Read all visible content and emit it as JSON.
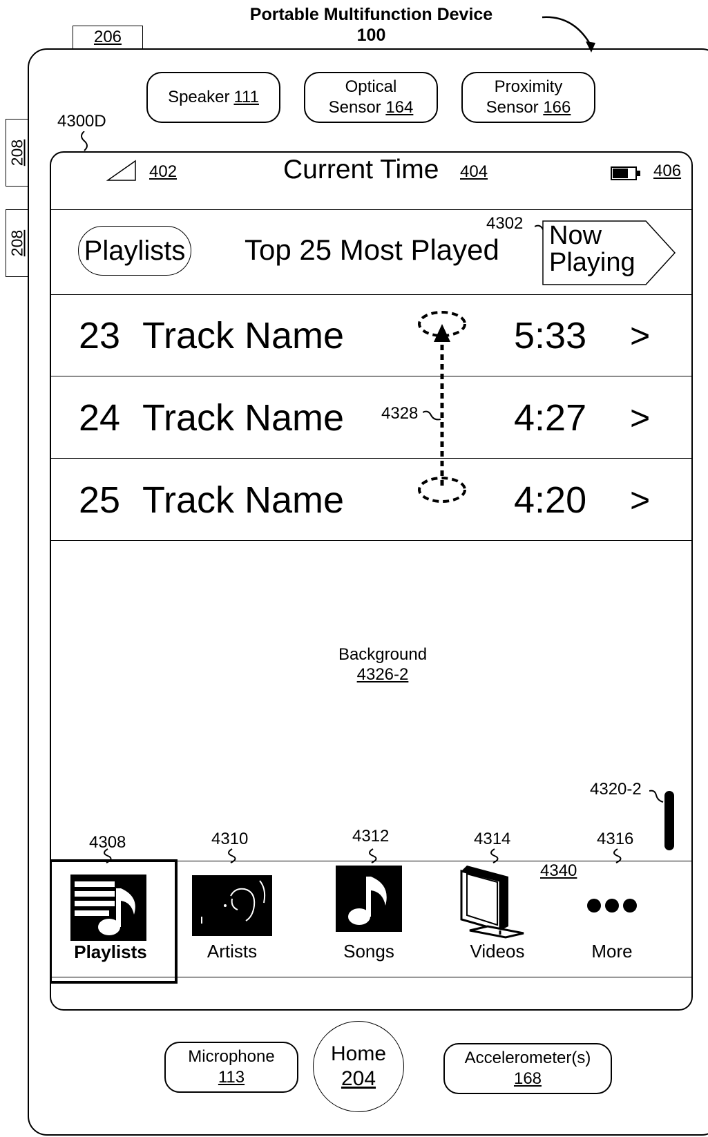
{
  "figure": {
    "title_line1": "Portable Multifunction Device",
    "title_line2": "100",
    "ref_206": "206",
    "ref_208a": "208",
    "ref_208b": "208",
    "ref_screen": "4300D"
  },
  "sensors_top": {
    "speaker_label": "Speaker",
    "speaker_ref": "111",
    "optical_label": "Optical",
    "optical_label2": "Sensor",
    "optical_ref": "164",
    "proximity_label": "Proximity",
    "proximity_label2": "Sensor",
    "proximity_ref": "166"
  },
  "status_bar": {
    "signal_ref": "402",
    "time": "Current Time",
    "time_ref": "404",
    "battery_ref": "406"
  },
  "nav_bar": {
    "back_label": "Playlists",
    "title": "Top 25 Most Played",
    "now_playing_line1": "Now",
    "now_playing_line2": "Playing",
    "now_playing_ref": "4302"
  },
  "tracks": [
    {
      "num": "23",
      "name": "Track Name",
      "duration": "5:33",
      "chevron": ">"
    },
    {
      "num": "24",
      "name": "Track Name",
      "duration": "4:27",
      "chevron": ">"
    },
    {
      "num": "25",
      "name": "Track Name",
      "duration": "4:20",
      "chevron": ">"
    }
  ],
  "gesture": {
    "ref": "4328"
  },
  "background": {
    "label": "Background",
    "ref": "4326-2"
  },
  "scroll_indicator": {
    "ref": "4320-2"
  },
  "tab_bar": {
    "ref": "4340",
    "tabs": [
      {
        "label": "Playlists",
        "ref": "4308",
        "icon": "playlist-icon",
        "selected": true
      },
      {
        "label": "Artists",
        "ref": "4310",
        "icon": "artist-icon"
      },
      {
        "label": "Songs",
        "ref": "4312",
        "icon": "music-note-icon"
      },
      {
        "label": "Videos",
        "ref": "4314",
        "icon": "tv-icon"
      },
      {
        "label": "More",
        "ref": "4316",
        "icon": "more-icon"
      }
    ]
  },
  "sensors_bottom": {
    "microphone_label": "Microphone",
    "microphone_ref": "113",
    "home_label": "Home",
    "home_ref": "204",
    "accel_label": "Accelerometer(s)",
    "accel_ref": "168"
  }
}
